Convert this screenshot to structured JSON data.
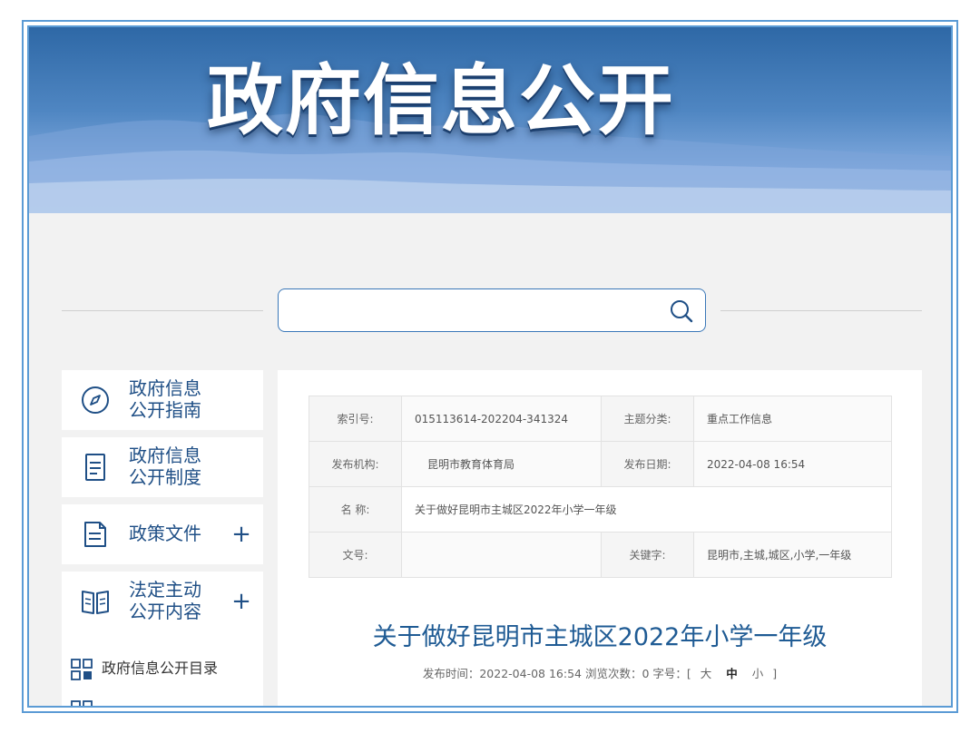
{
  "banner": {
    "title": "政府信息公开"
  },
  "search": {
    "value": "",
    "placeholder": ""
  },
  "sidebar": {
    "items": [
      {
        "line1": "政府信息",
        "line2": "公开指南",
        "icon": "compass-icon",
        "expandable": false
      },
      {
        "line1": "政府信息",
        "line2": "公开制度",
        "icon": "document-icon",
        "expandable": false
      },
      {
        "line1": "政策文件",
        "line2": "",
        "icon": "policy-file-icon",
        "expandable": true,
        "plus": "+"
      },
      {
        "line1": "法定主动",
        "line2": "公开内容",
        "icon": "open-book-icon",
        "expandable": true,
        "plus": "+"
      }
    ],
    "sub_items": [
      {
        "label": "政府信息公开目录",
        "icon": "grid-icon"
      }
    ]
  },
  "meta_table": {
    "index_label": "索引号:",
    "index_value": "015113614-202204-341324",
    "topic_label": "主题分类:",
    "topic_value": "重点工作信息",
    "org_label": "发布机构:",
    "org_value": "昆明市教育体育局",
    "date_label": "发布日期:",
    "date_value": "2022-04-08 16:54",
    "name_label": "名 称:",
    "name_value": "关于做好昆明市主城区2022年小学一年级",
    "docno_label": "文号:",
    "docno_value": "",
    "keywords_label": "关键字:",
    "keywords_value": "昆明市,主城,城区,小学,一年级"
  },
  "article": {
    "title": "关于做好昆明市主城区2022年小学一年级",
    "meta_prefix": "发布时间：2022-04-08 16:54 浏览次数：0 字号：[",
    "font_large": "大",
    "font_medium": "中",
    "font_small": "小",
    "meta_suffix": "]"
  },
  "colors": {
    "frame": "#5b9bd5",
    "accent": "#1f4f86",
    "title_blue": "#1f5b94",
    "banner_top": "#2e68a6"
  }
}
